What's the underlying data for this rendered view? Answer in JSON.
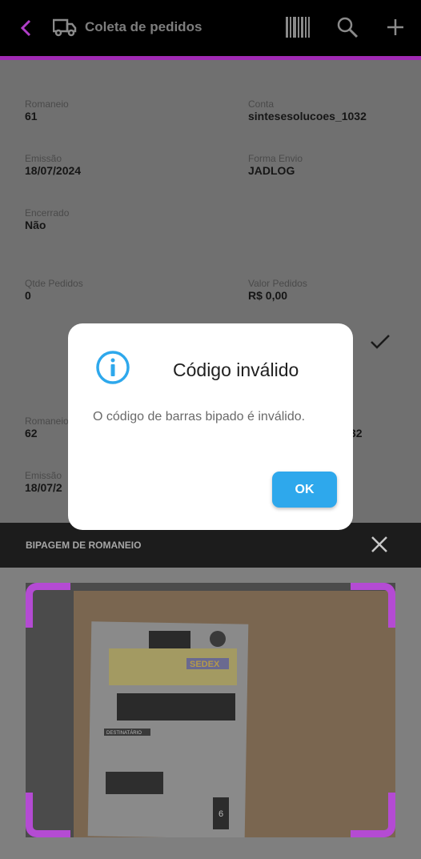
{
  "appbar": {
    "title": "Coleta de pedidos",
    "back_icon": "chevron-left-icon",
    "truck_icon": "truck-icon",
    "barcode_icon": "barcode-icon",
    "search_icon": "search-icon",
    "add_icon": "plus-icon",
    "accent_color": "#a02ab4"
  },
  "records": [
    {
      "romaneio_label": "Romaneio",
      "romaneio": "61",
      "conta_label": "Conta",
      "conta": "sintesesolucoes_1032",
      "emissao_label": "Emissão",
      "emissao": "18/07/2024",
      "forma_envio_label": "Forma Envio",
      "forma_envio": "JADLOG",
      "encerrado_label": "Encerrado",
      "encerrado": "Não",
      "qtde_label": "Qtde Pedidos",
      "qtde": "0",
      "valor_label": "Valor Pedidos",
      "valor": "R$ 0,00"
    },
    {
      "romaneio_label": "Romaneio",
      "romaneio": "62",
      "conta_fragment": "32",
      "emissao_label": "Emissão",
      "emissao": "18/07/2"
    }
  ],
  "scan": {
    "title": "BIPAGEM DE ROMANEIO",
    "close_icon": "close-icon",
    "frame_color": "#b44bd3"
  },
  "dialog": {
    "icon": "info-icon",
    "title": "Código inválido",
    "message": "O código de barras bipado é inválido.",
    "ok_label": "OK",
    "button_color": "#2ea8ec"
  },
  "package": {
    "sedex_label": "SEDEX",
    "destinatario_label": "DESTINATÁRIO",
    "number": "6"
  }
}
